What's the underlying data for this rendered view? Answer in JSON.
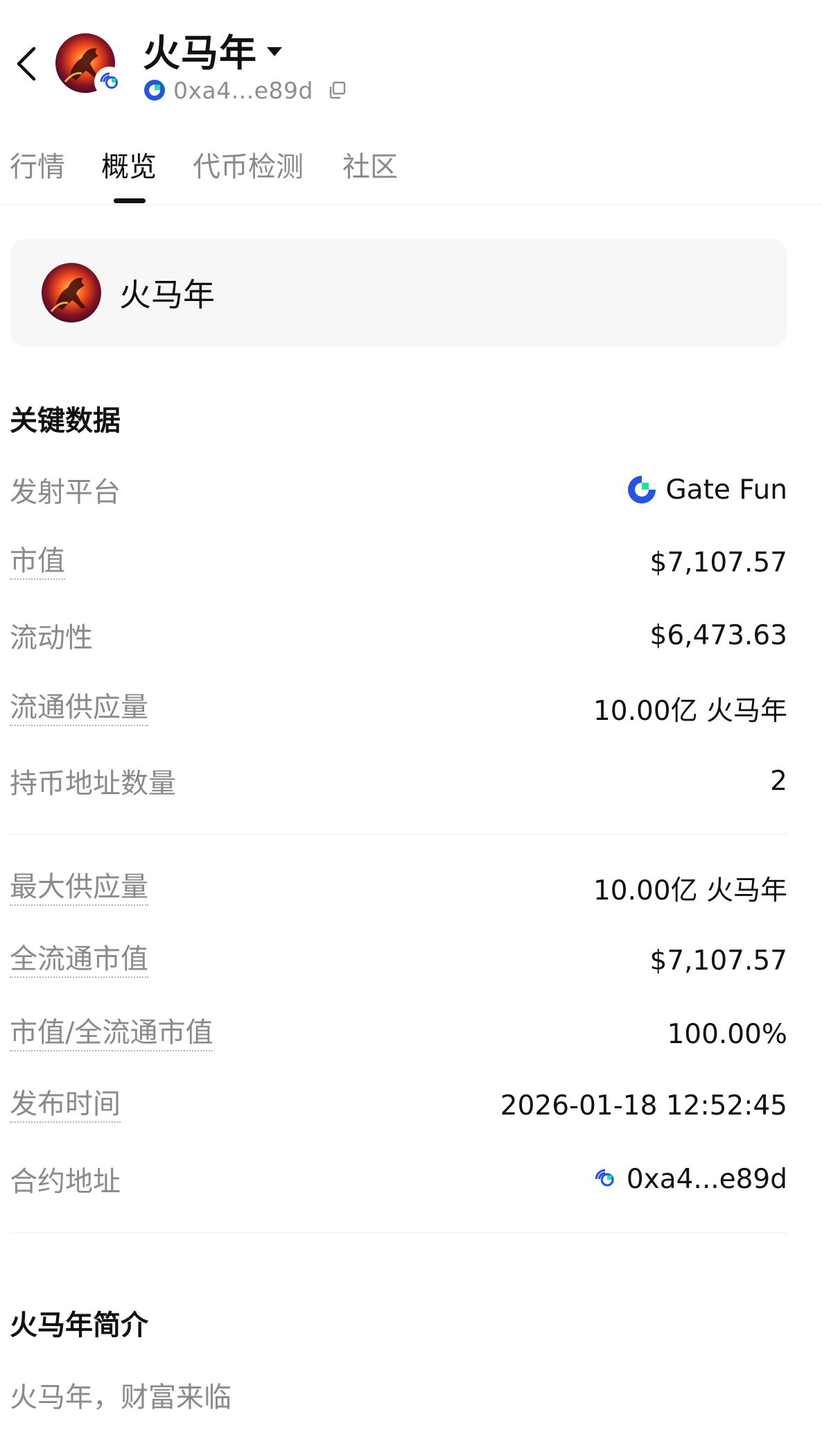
{
  "header": {
    "title": "火马年",
    "address": "0xa4...e89d"
  },
  "tabs": [
    {
      "label": "行情"
    },
    {
      "label": "概览"
    },
    {
      "label": "代币检测"
    },
    {
      "label": "社区"
    }
  ],
  "active_tab": "概览",
  "token_card": {
    "name": "火马年"
  },
  "key_data": {
    "title": "关键数据",
    "launch_platform": {
      "label": "发射平台",
      "value": "Gate Fun"
    },
    "market_cap": {
      "label": "市值",
      "value": "$7,107.57"
    },
    "liquidity": {
      "label": "流动性",
      "value": "$6,473.63"
    },
    "circulating_supply": {
      "label": "流通供应量",
      "value": "10.00亿 火马年"
    },
    "holders": {
      "label": "持币地址数量",
      "value": "2"
    },
    "max_supply": {
      "label": "最大供应量",
      "value": "10.00亿 火马年"
    },
    "fdv": {
      "label": "全流通市值",
      "value": "$7,107.57"
    },
    "mc_fdv_ratio": {
      "label": "市值/全流通市值",
      "value": "100.00%"
    },
    "launch_time": {
      "label": "发布时间",
      "value": "2026-01-18 12:52:45"
    },
    "contract": {
      "label": "合约地址",
      "value": "0xa4...e89d"
    }
  },
  "intro": {
    "title": "火马年简介",
    "text": "火马年，财富来临"
  },
  "icons": {
    "back": "chevron-left-icon",
    "caret": "caret-down-icon",
    "copy": "copy-icon",
    "gate_logo": "gate-logo-icon",
    "chain": "gate-chain-icon"
  },
  "colors": {
    "gate_blue": "#2354e6",
    "gate_teal": "#17e6a1",
    "text_primary": "#111111",
    "text_secondary": "#8a8a8a"
  }
}
